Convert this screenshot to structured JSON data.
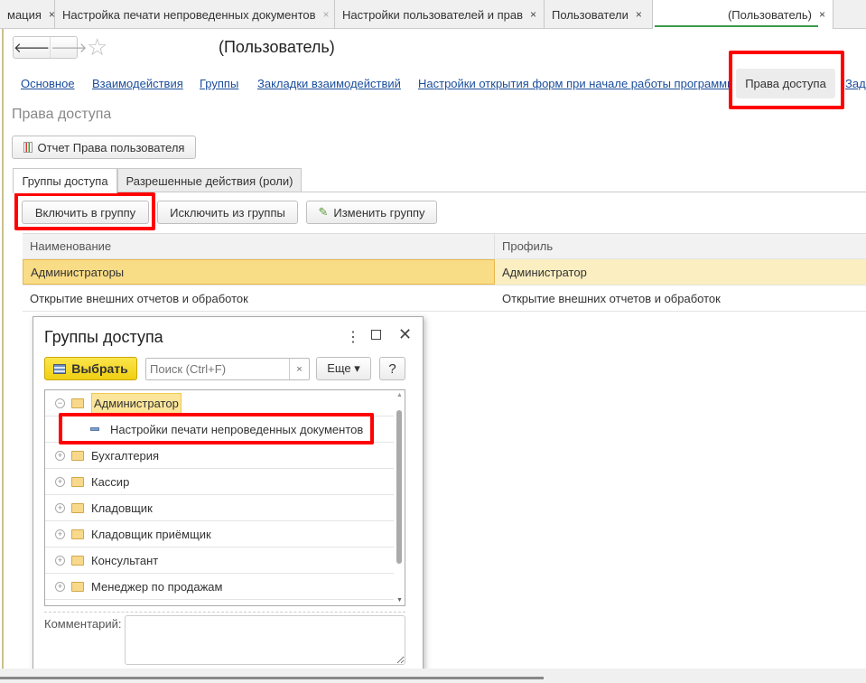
{
  "tabs": [
    {
      "label": "мация",
      "close": "×"
    },
    {
      "label": "Настройка печати непроведенных документов",
      "close": "×"
    },
    {
      "label": "Настройки пользователей и прав",
      "close": "×"
    },
    {
      "label": "Пользователи",
      "close": "×"
    },
    {
      "label": "(Пользователь)",
      "close": "×"
    }
  ],
  "header": {
    "title": "(Пользователь)",
    "back": "🡐",
    "forward": "🡒",
    "star": "☆"
  },
  "links": [
    "Основное",
    "Взаимодействия",
    "Группы",
    "Закладки взаимодействий",
    "Настройки открытия форм при начале работы программы"
  ],
  "active_section": "Права доступа",
  "more_link": "Зад",
  "section_title": "Права доступа",
  "report_button": "Отчет Права пользователя",
  "page_tabs": [
    "Группы доступа",
    "Разрешенные действия (роли)"
  ],
  "toolbar": {
    "include": "Включить в группу",
    "exclude": "Исключить из группы",
    "edit": "Изменить группу"
  },
  "grid": {
    "headers": [
      "Наименование",
      "Профиль"
    ],
    "rows": [
      [
        "Администраторы",
        "Администратор"
      ],
      [
        "Открытие внешних отчетов и обработок",
        "Открытие внешних отчетов и обработок"
      ]
    ]
  },
  "dialog": {
    "title": "Группы доступа",
    "select": "Выбрать",
    "search_placeholder": "Поиск (Ctrl+F)",
    "search_clear": "×",
    "more": "Еще ▾",
    "help": "?",
    "tree": [
      {
        "label": "Администратор",
        "expanded": true
      },
      {
        "label": "Настройки печати непроведенных документов",
        "child": true
      },
      {
        "label": "Бухгалтерия"
      },
      {
        "label": "Кассир"
      },
      {
        "label": "Кладовщик"
      },
      {
        "label": "Кладовщик приёмщик"
      },
      {
        "label": "Консультант"
      },
      {
        "label": "Менеджер по продажам"
      }
    ],
    "comment_label": "Комментарий:"
  }
}
